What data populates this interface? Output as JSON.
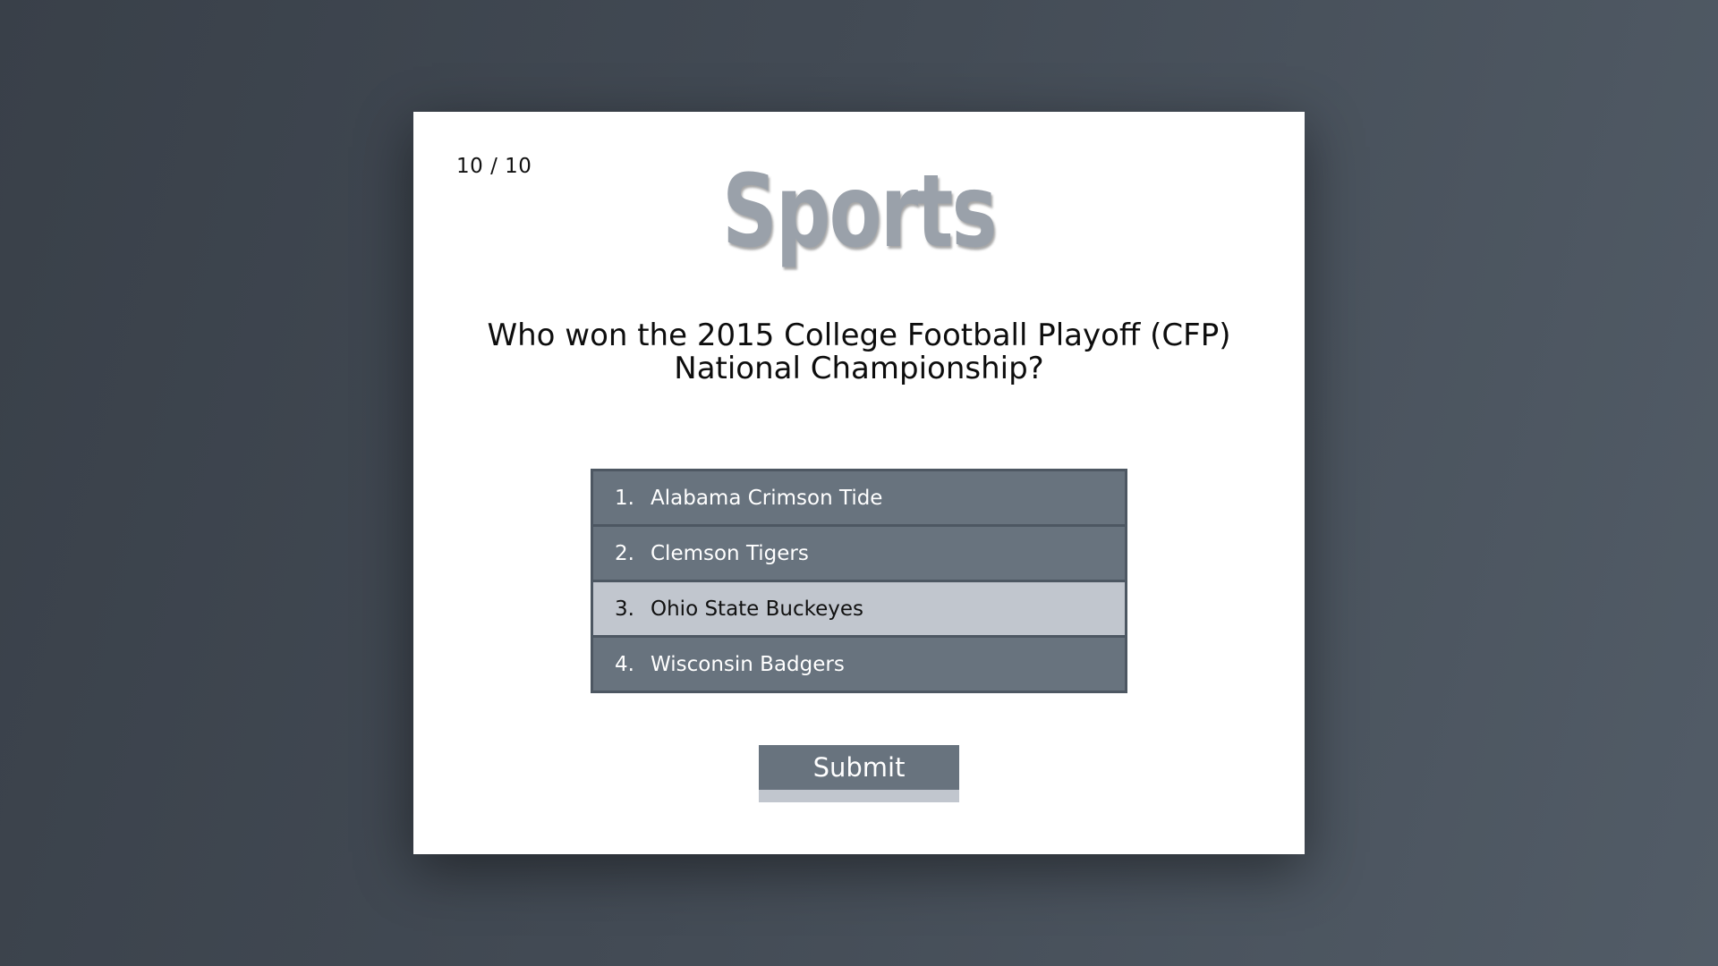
{
  "quiz": {
    "progress": "10 / 10",
    "category": "Sports",
    "question": "Who won the 2015 College Football Playoff (CFP) National Championship?",
    "answers": [
      {
        "number": "1.",
        "label": "Alabama Crimson Tide"
      },
      {
        "number": "2.",
        "label": "Clemson Tigers"
      },
      {
        "number": "3.",
        "label": "Ohio State Buckeyes"
      },
      {
        "number": "4.",
        "label": "Wisconsin Badgers"
      }
    ],
    "selected_answer": "3.",
    "submit_label": "Submit"
  },
  "colors": {
    "background": "#3d444d",
    "card": "#ffffff",
    "answer_bg": "#68737e",
    "answer_selected_bg": "#c1c6ce",
    "answer_border": "#4d5762",
    "category_text": "#9aa1aa"
  }
}
